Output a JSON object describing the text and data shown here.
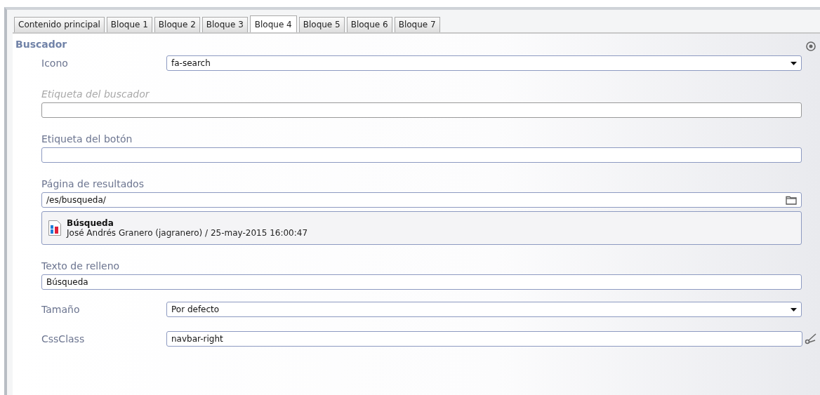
{
  "tabs": [
    {
      "label": "Contenido principal",
      "selected": false
    },
    {
      "label": "Bloque 1",
      "selected": false
    },
    {
      "label": "Bloque 2",
      "selected": false
    },
    {
      "label": "Bloque 3",
      "selected": false
    },
    {
      "label": "Bloque 4",
      "selected": true
    },
    {
      "label": "Bloque 5",
      "selected": false
    },
    {
      "label": "Bloque 6",
      "selected": false
    },
    {
      "label": "Bloque 7",
      "selected": false
    }
  ],
  "section": {
    "title": "Buscador"
  },
  "fields": [
    {
      "kind": "select",
      "label": "Icono",
      "value": "fa-search",
      "disabled": false
    },
    {
      "kind": "text",
      "label": "Etiqueta del buscador",
      "disabled": true
    },
    {
      "kind": "text",
      "label": "Etiqueta del botón",
      "disabled": false
    },
    {
      "kind": "page",
      "label": "Página de resultados",
      "value": "/es/busqueda/",
      "disabled": false,
      "page": {
        "title": "Búsqueda",
        "meta": "José Andrés Granero (jagranero) / 25-may-2015 16:00:47"
      }
    },
    {
      "kind": "text",
      "label": "Texto de relleno",
      "value": "Búsqueda",
      "disabled": false
    },
    {
      "kind": "select",
      "label": "Tamaño",
      "value": "Por defecto",
      "disabled": false
    },
    {
      "kind": "class",
      "label": "CssClass",
      "value": "navbar-right",
      "disabled": false
    }
  ]
}
